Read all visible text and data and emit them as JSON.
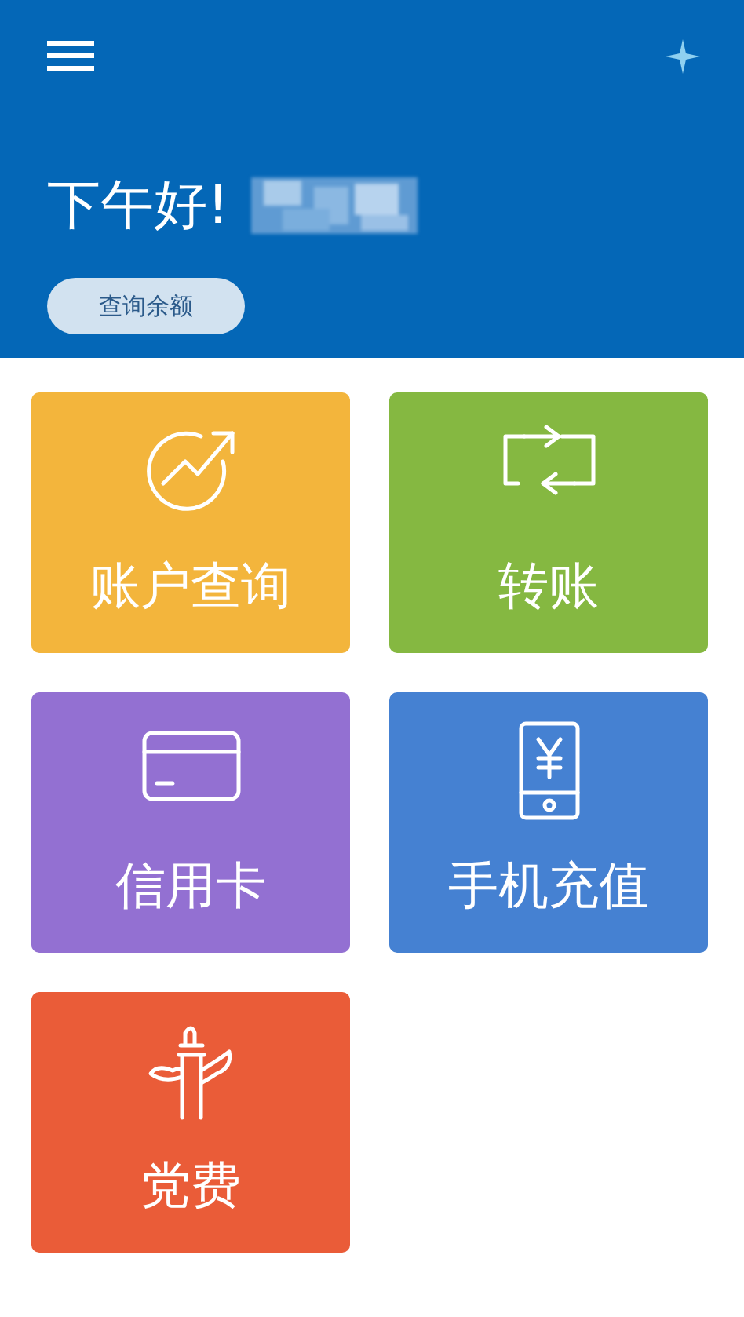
{
  "header": {
    "greeting": "下午好!",
    "name_redacted": true,
    "balance_button": "查询余额"
  },
  "tiles": [
    {
      "kind": "chart",
      "label": "账户查询",
      "color": "#f3b53c"
    },
    {
      "kind": "transfer",
      "label": "转账",
      "color": "#85b841"
    },
    {
      "kind": "card",
      "label": "信用卡",
      "color": "#9370d2"
    },
    {
      "kind": "phone",
      "label": "手机充值",
      "color": "#4581d2"
    },
    {
      "kind": "pillar",
      "label": "党费",
      "color": "#ea5c38"
    }
  ]
}
